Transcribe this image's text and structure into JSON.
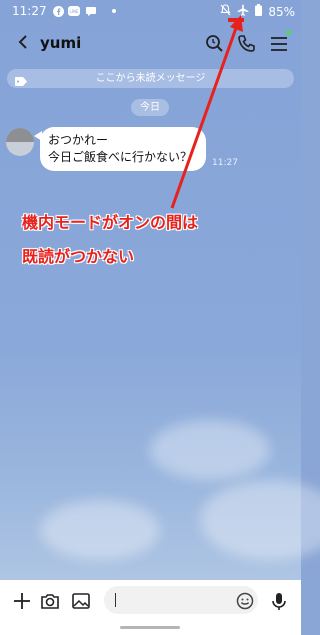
{
  "status_bar": {
    "time": "11:27",
    "battery_percent": "85%",
    "icons": [
      "facebook-icon",
      "line-icon",
      "chat-bubble-icon",
      "dot-icon",
      "bell-off-icon",
      "airplane-icon",
      "battery-icon"
    ]
  },
  "header": {
    "title": "yumi",
    "icons": [
      "back-icon",
      "search-icon",
      "phone-icon",
      "menu-icon"
    ]
  },
  "chat": {
    "unread_banner": "ここから未読メッセージ",
    "date_label": "今日",
    "message": {
      "line1": "おつかれー",
      "line2": "今日ご飯食べに行かない？",
      "time": "11:27"
    }
  },
  "annotation": {
    "line1": "機内モードがオンの間は",
    "line2": "既読がつかない",
    "color": "#e8211c"
  },
  "input_bar": {
    "placeholder": "",
    "icons": [
      "plus-icon",
      "camera-icon",
      "image-icon",
      "emoji-icon",
      "mic-icon"
    ]
  },
  "colors": {
    "background": "#8aa6d6",
    "annotation_red": "#e8211c"
  }
}
